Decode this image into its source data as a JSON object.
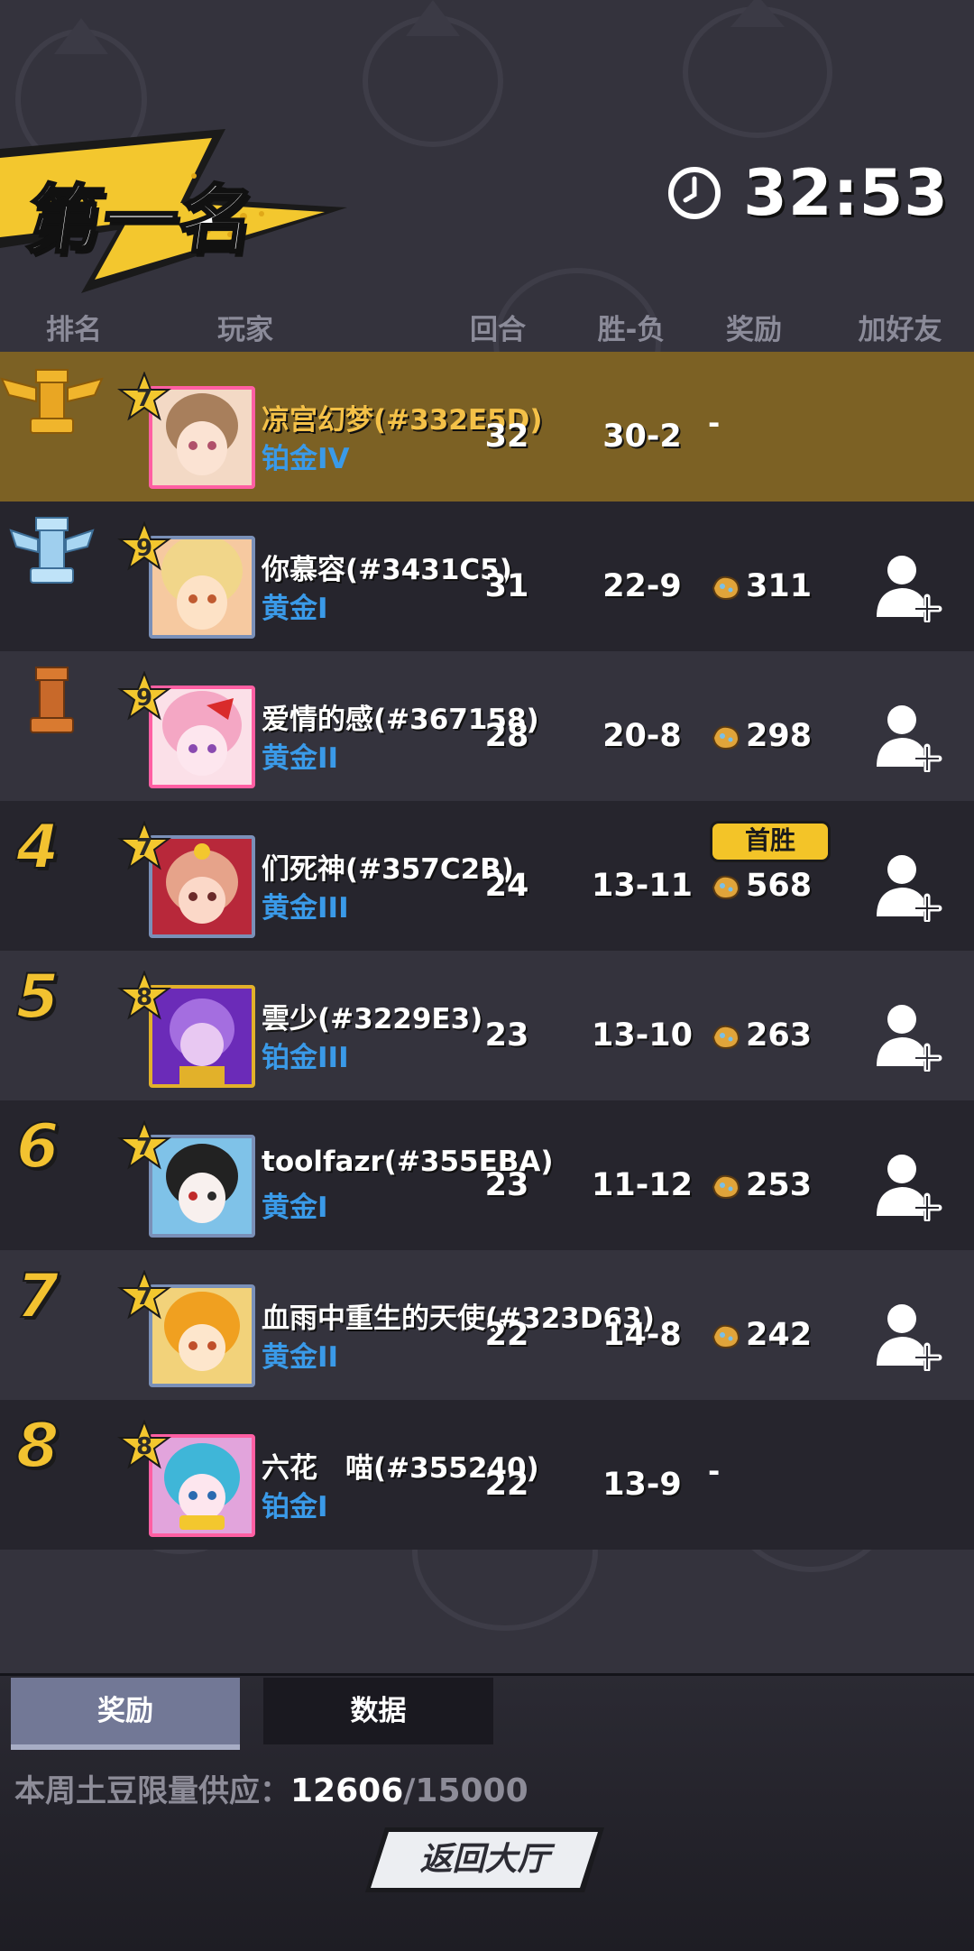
{
  "banner": {
    "title": "第一名"
  },
  "timer": {
    "value": "32:53",
    "icon": "clock-icon"
  },
  "columns": [
    "排名",
    "玩家",
    "回合",
    "胜-负",
    "奖励",
    "加好友"
  ],
  "players": [
    {
      "rank": "1",
      "level": "7",
      "name": "凉宫幻梦(#332E5D)",
      "tier": "铂金IV",
      "rounds": "32",
      "record": "30-2",
      "reward": "-",
      "first_win": false,
      "add_friend": false
    },
    {
      "rank": "2",
      "level": "9",
      "name": "你慕容(#3431C5)",
      "tier": "黄金I",
      "rounds": "31",
      "record": "22-9",
      "reward": "311",
      "first_win": false,
      "add_friend": true
    },
    {
      "rank": "3",
      "level": "9",
      "name": "爱情的感(#367158)",
      "tier": "黄金II",
      "rounds": "28",
      "record": "20-8",
      "reward": "298",
      "first_win": false,
      "add_friend": true
    },
    {
      "rank": "4",
      "level": "7",
      "name": "们死神(#357C2B)",
      "tier": "黄金III",
      "rounds": "24",
      "record": "13-11",
      "reward": "568",
      "first_win": true,
      "add_friend": true
    },
    {
      "rank": "5",
      "level": "8",
      "name": "雲少(#3229E3)",
      "tier": "铂金III",
      "rounds": "23",
      "record": "13-10",
      "reward": "263",
      "first_win": false,
      "add_friend": true
    },
    {
      "rank": "6",
      "level": "7",
      "name": "toolfazr(#355EBA)",
      "tier": "黄金I",
      "rounds": "23",
      "record": "11-12",
      "reward": "253",
      "first_win": false,
      "add_friend": true
    },
    {
      "rank": "7",
      "level": "7",
      "name": "血雨中重生的天使(#323D63)",
      "tier": "黄金II",
      "rounds": "22",
      "record": "14-8",
      "reward": "242",
      "first_win": false,
      "add_friend": true
    },
    {
      "rank": "8",
      "level": "8",
      "name": "六花　喵(#355240)",
      "tier": "铂金I",
      "rounds": "22",
      "record": "13-9",
      "reward": "-",
      "first_win": false,
      "add_friend": false
    }
  ],
  "first_win_label": "首胜",
  "tabs": {
    "reward": "奖励",
    "data": "数据"
  },
  "supply": {
    "label": "本周土豆限量供应：",
    "current": "12606",
    "separator": "/",
    "max": "15000"
  },
  "back_button": "返回大厅",
  "colors": {
    "gold": "#f2c230",
    "tier_blue": "#3a9ae8",
    "first_row": "#7c6124"
  }
}
